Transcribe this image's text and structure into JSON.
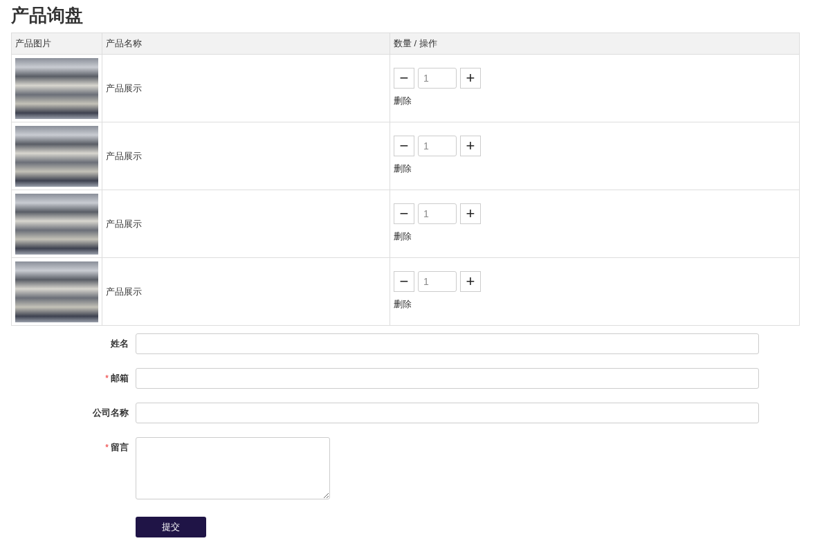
{
  "title": "产品询盘",
  "table": {
    "columns": [
      "产品图片",
      "产品名称",
      "数量 / 操作"
    ],
    "rows": [
      {
        "name": "产品展示",
        "quantity": "1",
        "minus": "−",
        "plus": "+",
        "delete": "删除"
      },
      {
        "name": "产品展示",
        "quantity": "1",
        "minus": "−",
        "plus": "+",
        "delete": "删除"
      },
      {
        "name": "产品展示",
        "quantity": "1",
        "minus": "−",
        "plus": "+",
        "delete": "删除"
      },
      {
        "name": "产品展示",
        "quantity": "1",
        "minus": "−",
        "plus": "+",
        "delete": "删除"
      }
    ]
  },
  "form": {
    "fields": [
      {
        "label": "姓名",
        "kind": "text"
      },
      {
        "label": "邮箱",
        "required_mark": "*",
        "kind": "text"
      },
      {
        "label": "公司名称",
        "kind": "text"
      },
      {
        "label": "留言",
        "required_mark": "*",
        "kind": "textarea"
      }
    ],
    "submit": "提交"
  }
}
